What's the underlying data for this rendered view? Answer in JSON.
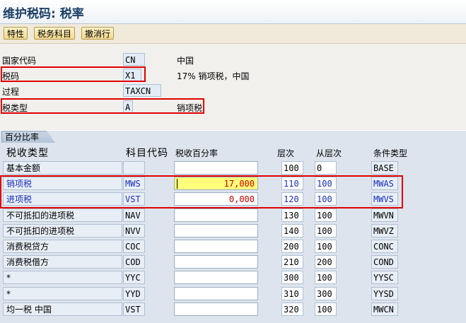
{
  "window": {
    "title": "维护税码: 税率"
  },
  "toolbar": {
    "buttons": [
      "特性",
      "税务科目",
      "撤消行"
    ]
  },
  "header": {
    "country_label": "国家代码",
    "country_value": "CN",
    "country_desc": "中国",
    "taxcode_label": "税码",
    "taxcode_value": "X1",
    "taxcode_desc": "17% 销项税，中国",
    "procedure_label": "过程",
    "procedure_value": "TAXCN",
    "taxtype_label": "税类型",
    "taxtype_value": "A",
    "taxtype_desc": "销项税"
  },
  "table": {
    "tab_label": "百分比率",
    "columns": [
      "税收类型",
      "科目代码",
      "税收百分率",
      "层次",
      "从层次",
      "条件类型"
    ],
    "rows": [
      {
        "name": "基本金额",
        "code": "",
        "pct": "",
        "level": "100",
        "from": "0",
        "cond": "BASE"
      },
      {
        "name": "销项税",
        "code": "MWS",
        "pct": "17,000",
        "level": "110",
        "from": "100",
        "cond": "MWAS"
      },
      {
        "name": "进项税",
        "code": "VST",
        "pct": "0,000",
        "level": "120",
        "from": "100",
        "cond": "MWVS"
      },
      {
        "name": "不可抵扣的进项税",
        "code": "NAV",
        "pct": "",
        "level": "130",
        "from": "100",
        "cond": "MWVN"
      },
      {
        "name": "不可抵扣的进项税",
        "code": "NVV",
        "pct": "",
        "level": "140",
        "from": "100",
        "cond": "MWVZ"
      },
      {
        "name": "消费税贷方",
        "code": "COC",
        "pct": "",
        "level": "200",
        "from": "100",
        "cond": "CONC"
      },
      {
        "name": "消费税借方",
        "code": "COD",
        "pct": "",
        "level": "210",
        "from": "200",
        "cond": "COND"
      },
      {
        "name": "*",
        "code": "YYC",
        "pct": "",
        "level": "300",
        "from": "100",
        "cond": "YYSC"
      },
      {
        "name": "*",
        "code": "YYD",
        "pct": "",
        "level": "310",
        "from": "300",
        "cond": "YYSD"
      },
      {
        "name": "均一税 中国",
        "code": "VST",
        "pct": "",
        "level": "320",
        "from": "100",
        "cond": "MWCN"
      }
    ]
  },
  "colors": {
    "highlight_red": "#e00000",
    "yellow_field": "#ffff7a",
    "title_blue": "#1c3f66"
  }
}
